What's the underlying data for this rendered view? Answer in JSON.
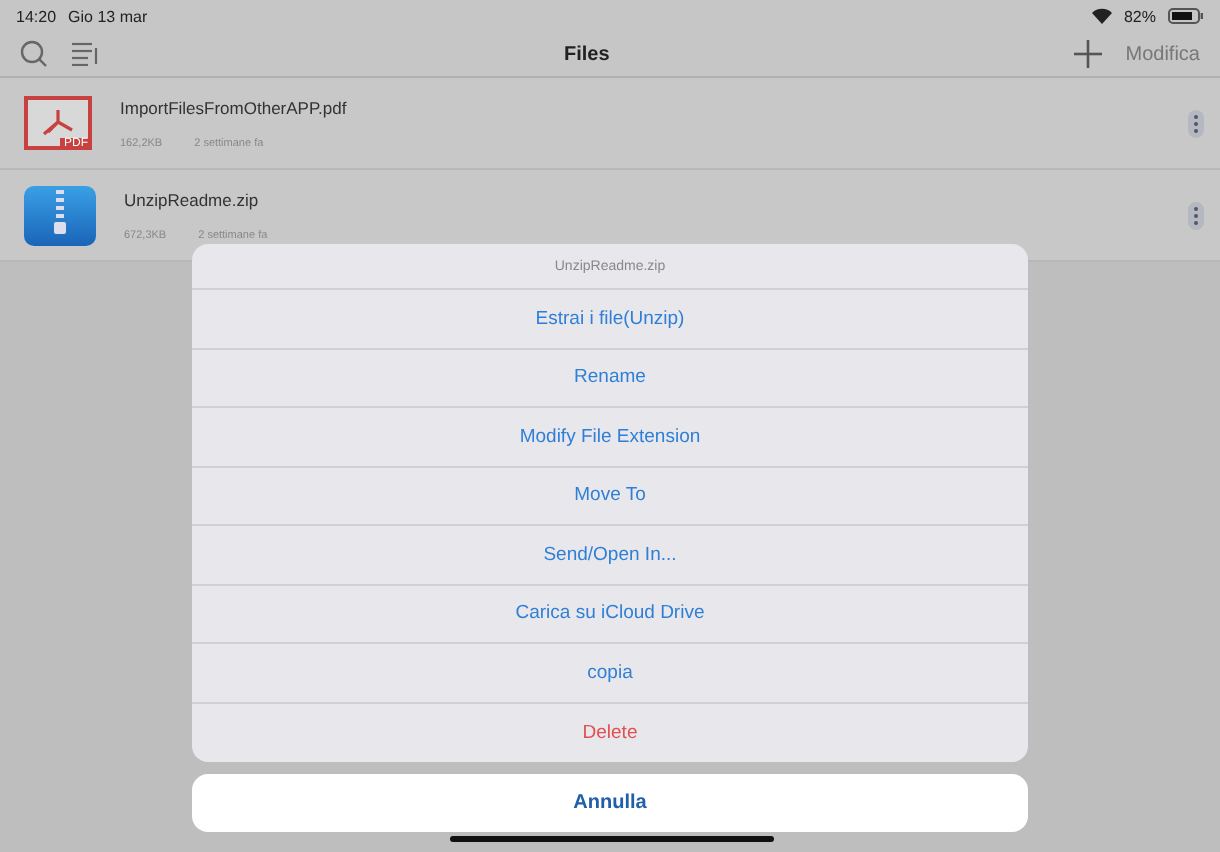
{
  "status_bar": {
    "time": "14:20",
    "date": "Gio 13 mar",
    "battery": "82%"
  },
  "nav": {
    "title": "Files",
    "edit": "Modifica"
  },
  "files": [
    {
      "name": "ImportFilesFromOtherAPP.pdf",
      "size": "162,2KB",
      "date": "2 settimane fa",
      "kind": "pdf",
      "badge": "PDF"
    },
    {
      "name": "UnzipReadme.zip",
      "size": "672,3KB",
      "date": "2 settimane fa",
      "kind": "zip"
    }
  ],
  "action_sheet": {
    "title": "UnzipReadme.zip",
    "actions": [
      {
        "label": "Estrai i file(Unzip)",
        "kind": "default"
      },
      {
        "label": "Rename",
        "kind": "default"
      },
      {
        "label": "Modify File Extension",
        "kind": "default"
      },
      {
        "label": "Move To",
        "kind": "default"
      },
      {
        "label": "Send/Open In...",
        "kind": "default"
      },
      {
        "label": "Carica su iCloud Drive",
        "kind": "default"
      },
      {
        "label": "copia",
        "kind": "default"
      },
      {
        "label": "Delete",
        "kind": "destructive"
      }
    ],
    "cancel": "Annulla"
  }
}
